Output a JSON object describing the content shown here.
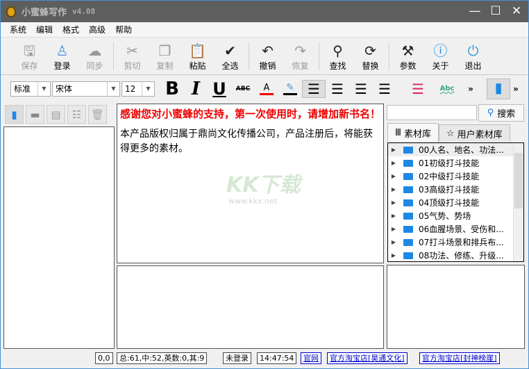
{
  "window": {
    "title": "小蜜蜂写作",
    "version": "v4.08"
  },
  "menu": [
    "系统",
    "编辑",
    "格式",
    "高级",
    "帮助"
  ],
  "toolbar": [
    {
      "label": "保存",
      "icon": "floppy-icon",
      "glyph": "🖫",
      "disabled": true
    },
    {
      "label": "登录",
      "icon": "user-icon",
      "glyph": "♙",
      "disabled": false
    },
    {
      "label": "同步",
      "icon": "cloud-icon",
      "glyph": "☁",
      "disabled": true
    },
    {
      "label": "剪切",
      "icon": "scissors-icon",
      "glyph": "✂",
      "disabled": true
    },
    {
      "label": "复制",
      "icon": "copy-icon",
      "glyph": "❐",
      "disabled": true
    },
    {
      "label": "粘贴",
      "icon": "clipboard-icon",
      "glyph": "📋",
      "disabled": false
    },
    {
      "label": "全选",
      "icon": "select-all-icon",
      "glyph": "✔",
      "disabled": false
    },
    {
      "label": "撤销",
      "icon": "undo-icon",
      "glyph": "↶",
      "disabled": false
    },
    {
      "label": "恢复",
      "icon": "redo-icon",
      "glyph": "↷",
      "disabled": true
    },
    {
      "label": "查找",
      "icon": "search-icon",
      "glyph": "⚲",
      "disabled": false
    },
    {
      "label": "替换",
      "icon": "replace-icon",
      "glyph": "⟳",
      "disabled": false
    },
    {
      "label": "参数",
      "icon": "tools-icon",
      "glyph": "⚒",
      "disabled": false
    },
    {
      "label": "关于",
      "icon": "info-icon",
      "glyph": "ⓘ",
      "disabled": false
    },
    {
      "label": "退出",
      "icon": "power-icon",
      "glyph": "⏻",
      "disabled": false
    }
  ],
  "format": {
    "style": "标准",
    "font": "宋体",
    "size": "12",
    "bold": "B",
    "italic": "I",
    "underline": "U",
    "strike": "ABC",
    "color": "A",
    "spell": "Abc",
    "more": "»"
  },
  "editor": {
    "notice": "感谢您对小蜜蜂的支持，第一次使用时，请增加新书名！",
    "info": "本产品版权归属于鼎尚文化传播公司，产品注册后，将能获得更多的素材。"
  },
  "watermark": {
    "text": "KK下载",
    "url": "www.kkx.net"
  },
  "right": {
    "search_placeholder": "",
    "search_label": "搜索",
    "tabs": [
      "素材库",
      "用户素材库"
    ],
    "tree": [
      "00人名、地名、功法...",
      "01初级打斗技能",
      "02中级打斗技能",
      "03高级打斗技能",
      "04顶级打斗技能",
      "05气势、势场",
      "06血腥场景、受伤和...",
      "07打斗场景和排兵布...",
      "08功法、修练、升级..."
    ]
  },
  "status": {
    "pos": "0,0",
    "count": "总:61,中:52,英数:0,其:9",
    "login": "未登录",
    "time": "14:47:54",
    "links": [
      "官网",
      "官方淘宝店[昊通文化]",
      "官方淘宝店[封神榜崖]"
    ]
  },
  "colors": {
    "titlebar": "#5e5e5e",
    "notice": "#ee0000",
    "folder": "#1e88e5",
    "link": "#0000cc"
  }
}
